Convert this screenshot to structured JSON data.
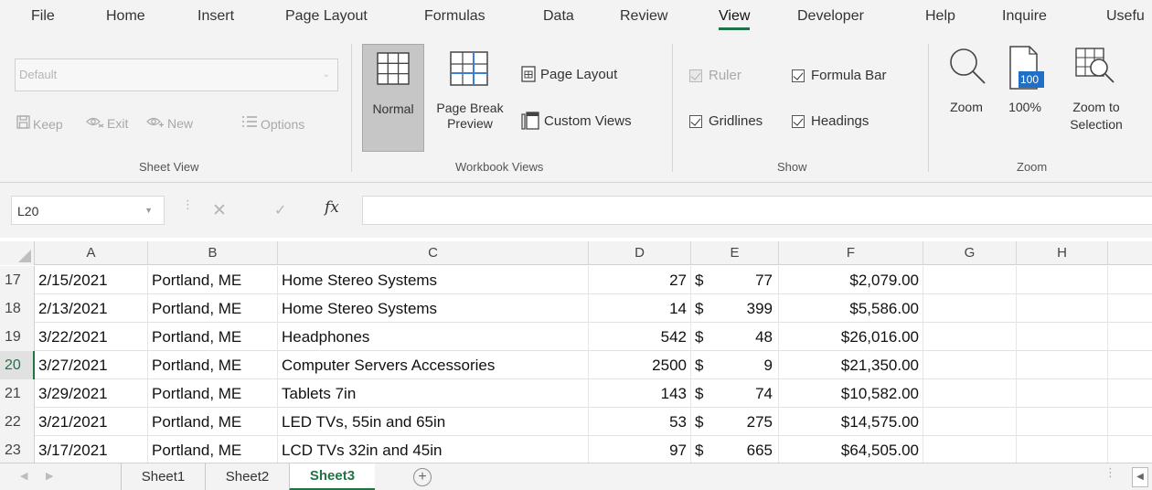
{
  "menu": {
    "tabs": [
      "File",
      "Home",
      "Insert",
      "Page Layout",
      "Formulas",
      "Data",
      "Review",
      "View",
      "Developer",
      "Help",
      "Inquire",
      "Usefu"
    ],
    "active_tab": "View"
  },
  "ribbon": {
    "sheet_view": {
      "group_label": "Sheet View",
      "dropdown_value": "Default",
      "keep_label": "Keep",
      "exit_label": "Exit",
      "new_label": "New",
      "options_label": "Options"
    },
    "workbook_views": {
      "group_label": "Workbook Views",
      "normal_label": "Normal",
      "page_break_label_1": "Page Break",
      "page_break_label_2": "Preview",
      "page_layout_label": "Page Layout",
      "custom_views_label": "Custom Views"
    },
    "show": {
      "group_label": "Show",
      "ruler_label": "Ruler",
      "formula_bar_label": "Formula Bar",
      "gridlines_label": "Gridlines",
      "headings_label": "Headings"
    },
    "zoom": {
      "group_label": "Zoom",
      "zoom_label": "Zoom",
      "hundred_label": "100%",
      "hundred_icon_text": "100",
      "zoom_sel_label_1": "Zoom to",
      "zoom_sel_label_2": "Selection"
    }
  },
  "formula_bar": {
    "name_box": "L20",
    "fx_label": "fx",
    "formula": ""
  },
  "grid": {
    "columns": [
      "A",
      "B",
      "C",
      "D",
      "E",
      "F",
      "G",
      "H"
    ],
    "selected_row": "20",
    "rows": [
      {
        "num": "17",
        "a": "2/15/2021",
        "b": "Portland, ME",
        "c": "Home Stereo Systems",
        "d": "27",
        "e_cur": "$",
        "e": "77",
        "f": "$2,079.00"
      },
      {
        "num": "18",
        "a": "2/13/2021",
        "b": "Portland, ME",
        "c": "Home Stereo Systems",
        "d": "14",
        "e_cur": "$",
        "e": "399",
        "f": "$5,586.00"
      },
      {
        "num": "19",
        "a": "3/22/2021",
        "b": "Portland, ME",
        "c": "Headphones",
        "d": "542",
        "e_cur": "$",
        "e": "48",
        "f": "$26,016.00"
      },
      {
        "num": "20",
        "a": "3/27/2021",
        "b": "Portland, ME",
        "c": "Computer Servers Accessories",
        "d": "2500",
        "e_cur": "$",
        "e": "9",
        "f": "$21,350.00"
      },
      {
        "num": "21",
        "a": "3/29/2021",
        "b": "Portland, ME",
        "c": "Tablets 7in",
        "d": "143",
        "e_cur": "$",
        "e": "74",
        "f": "$10,582.00"
      },
      {
        "num": "22",
        "a": "3/21/2021",
        "b": "Portland, ME",
        "c": "LED TVs, 55in and 65in",
        "d": "53",
        "e_cur": "$",
        "e": "275",
        "f": "$14,575.00"
      },
      {
        "num": "23",
        "a": "3/17/2021",
        "b": "Portland, ME",
        "c": "LCD TVs 32in and 45in",
        "d": "97",
        "e_cur": "$",
        "e": "665",
        "f": "$64,505.00"
      }
    ]
  },
  "sheets": {
    "tabs": [
      "Sheet1",
      "Sheet2",
      "Sheet3"
    ],
    "active": "Sheet3",
    "add_label": "+"
  },
  "colors": {
    "accent": "#217346",
    "ribbon_bg": "#f3f3f3"
  }
}
